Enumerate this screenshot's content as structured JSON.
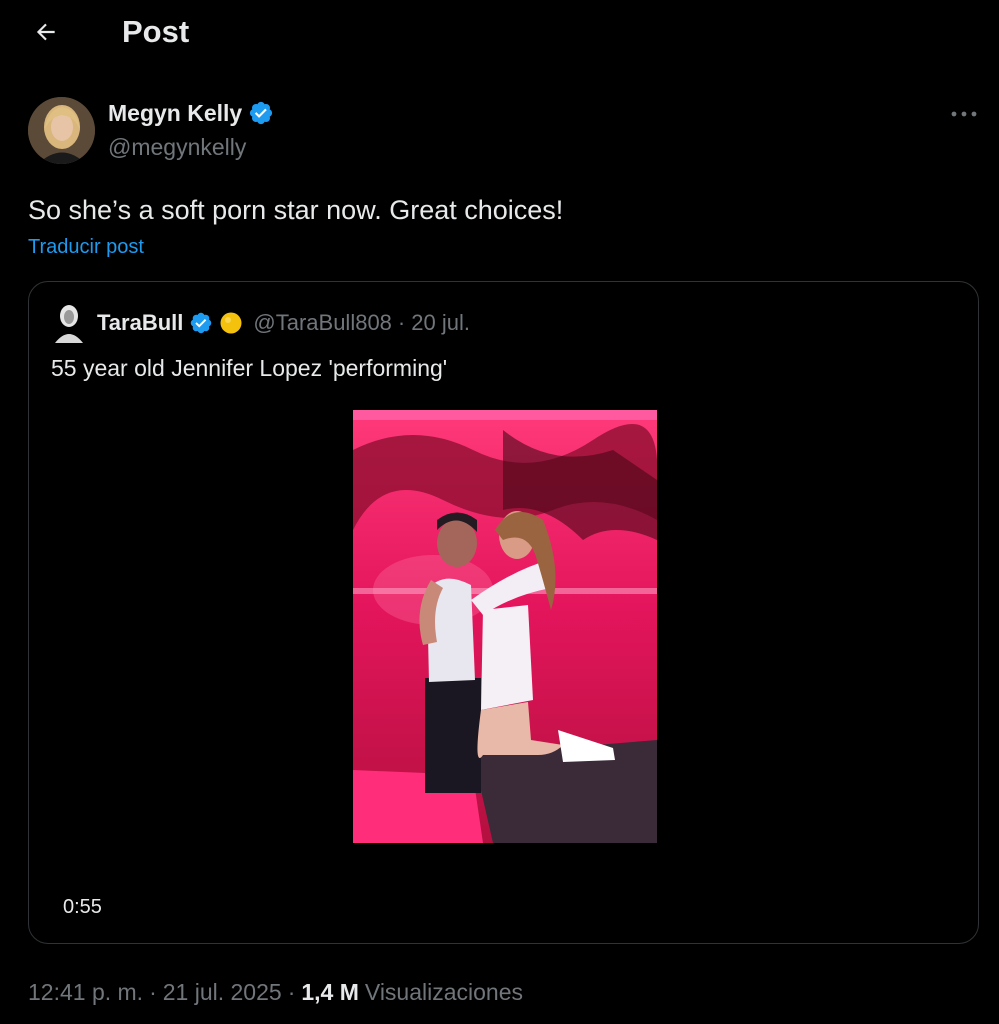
{
  "header": {
    "title": "Post",
    "back_icon": "arrow-left-icon"
  },
  "author": {
    "name": "Megyn Kelly",
    "handle": "@megynkelly",
    "verified_icon": "verified-badge-icon"
  },
  "post": {
    "text": "So she’s a soft porn star now. Great choices!",
    "translate_label": "Traducir post"
  },
  "quoted": {
    "name": "TaraBull",
    "handle": "@TaraBull808",
    "separator": "·",
    "date": "20 jul.",
    "text": "55 year old Jennifer Lopez 'performing'",
    "video_duration": "0:55",
    "badge_icon": "yellow-circle-emoji-icon"
  },
  "meta": {
    "time": "12:41 p. m.",
    "separator": "·",
    "date": "21 jul. 2025",
    "separator2": "·",
    "views_count": "1,4 M",
    "views_label": "Visualizaciones"
  },
  "colors": {
    "background": "#000000",
    "text_primary": "#e7e9ea",
    "text_secondary": "#71767b",
    "accent": "#1d9bf0",
    "border": "#2f3336"
  }
}
